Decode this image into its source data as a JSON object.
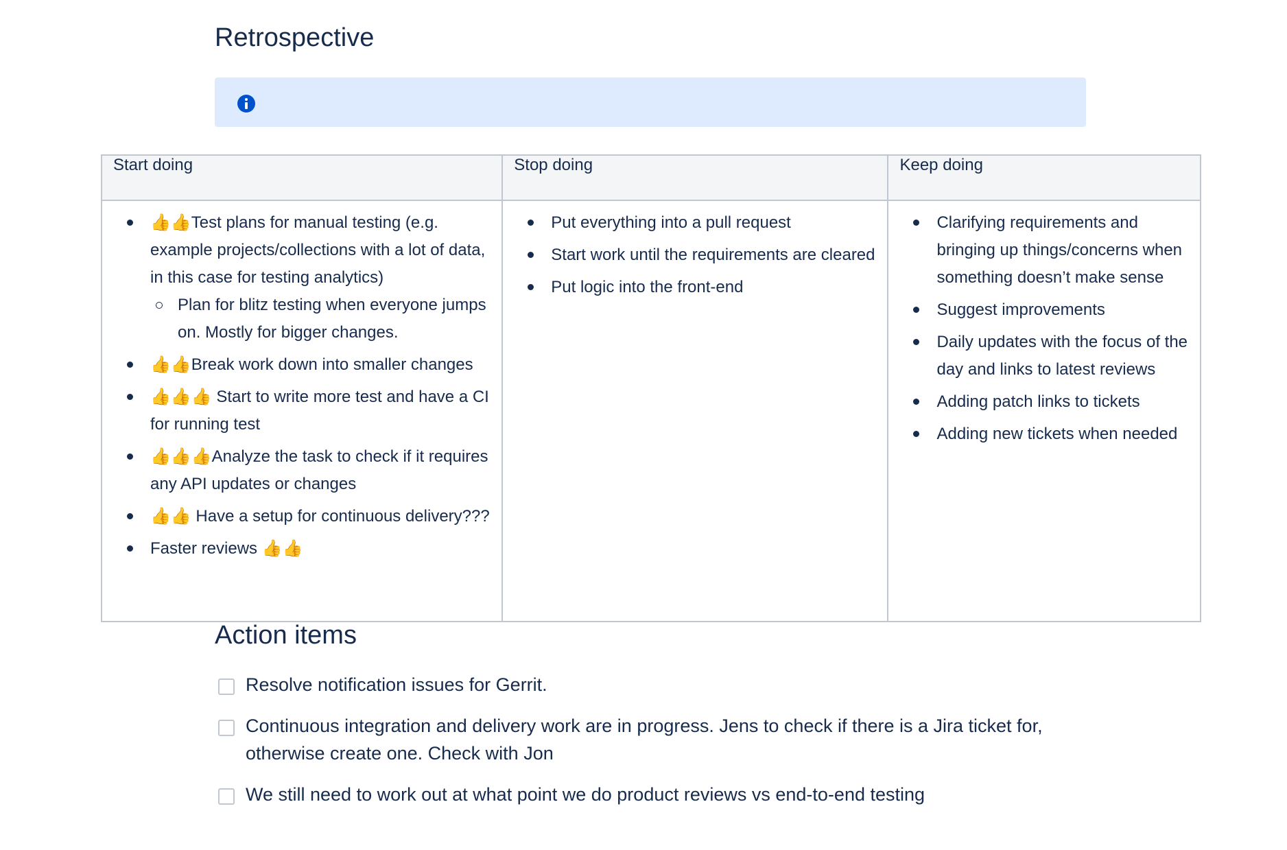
{
  "page": {
    "title": "Retrospective",
    "info_panel": {
      "icon": "info-icon",
      "text": ""
    }
  },
  "retro_table": {
    "headers": [
      "Start doing",
      "Stop doing",
      "Keep doing"
    ],
    "start_doing": [
      "👍👍Test plans for manual testing (e.g. example projects/collections with a lot of data, in this case for testing analytics)",
      "👍👍Break work down into smaller changes",
      "👍👍👍 Start to write more test and have a CI for running test",
      "👍👍👍Analyze the task to check if it requires any API updates or changes",
      "👍👍 Have a setup for continuous delivery???",
      "Faster reviews 👍👍"
    ],
    "start_doing_sub": [
      "Plan for blitz testing when everyone jumps on. Mostly for bigger changes."
    ],
    "stop_doing": [
      "Put everything into a pull request",
      "Start work until the requirements are cleared",
      "Put logic into the front-end"
    ],
    "keep_doing": [
      "Clarifying requirements and bringing up things/concerns when something doesn’t make sense",
      "Suggest improvements",
      "Daily updates with the focus of the day and links to latest reviews",
      "Adding patch links to tickets",
      "Adding new tickets when needed"
    ]
  },
  "action_items": {
    "title": "Action items",
    "tasks": [
      {
        "text": "Resolve notification issues for Gerrit.",
        "checked": false
      },
      {
        "text": "Continuous integration and delivery work are in progress. Jens to check if there is a Jira ticket for, otherwise create one. Check with Jon",
        "checked": false
      },
      {
        "text": "We still need to work out at what point we do product reviews vs end-to-end testing",
        "checked": false
      }
    ]
  },
  "colors": {
    "text": "#172b4d",
    "info_bg": "#deebff",
    "info_icon": "#0052cc",
    "table_header_bg": "#f4f5f7",
    "border": "#c1c7d0"
  }
}
